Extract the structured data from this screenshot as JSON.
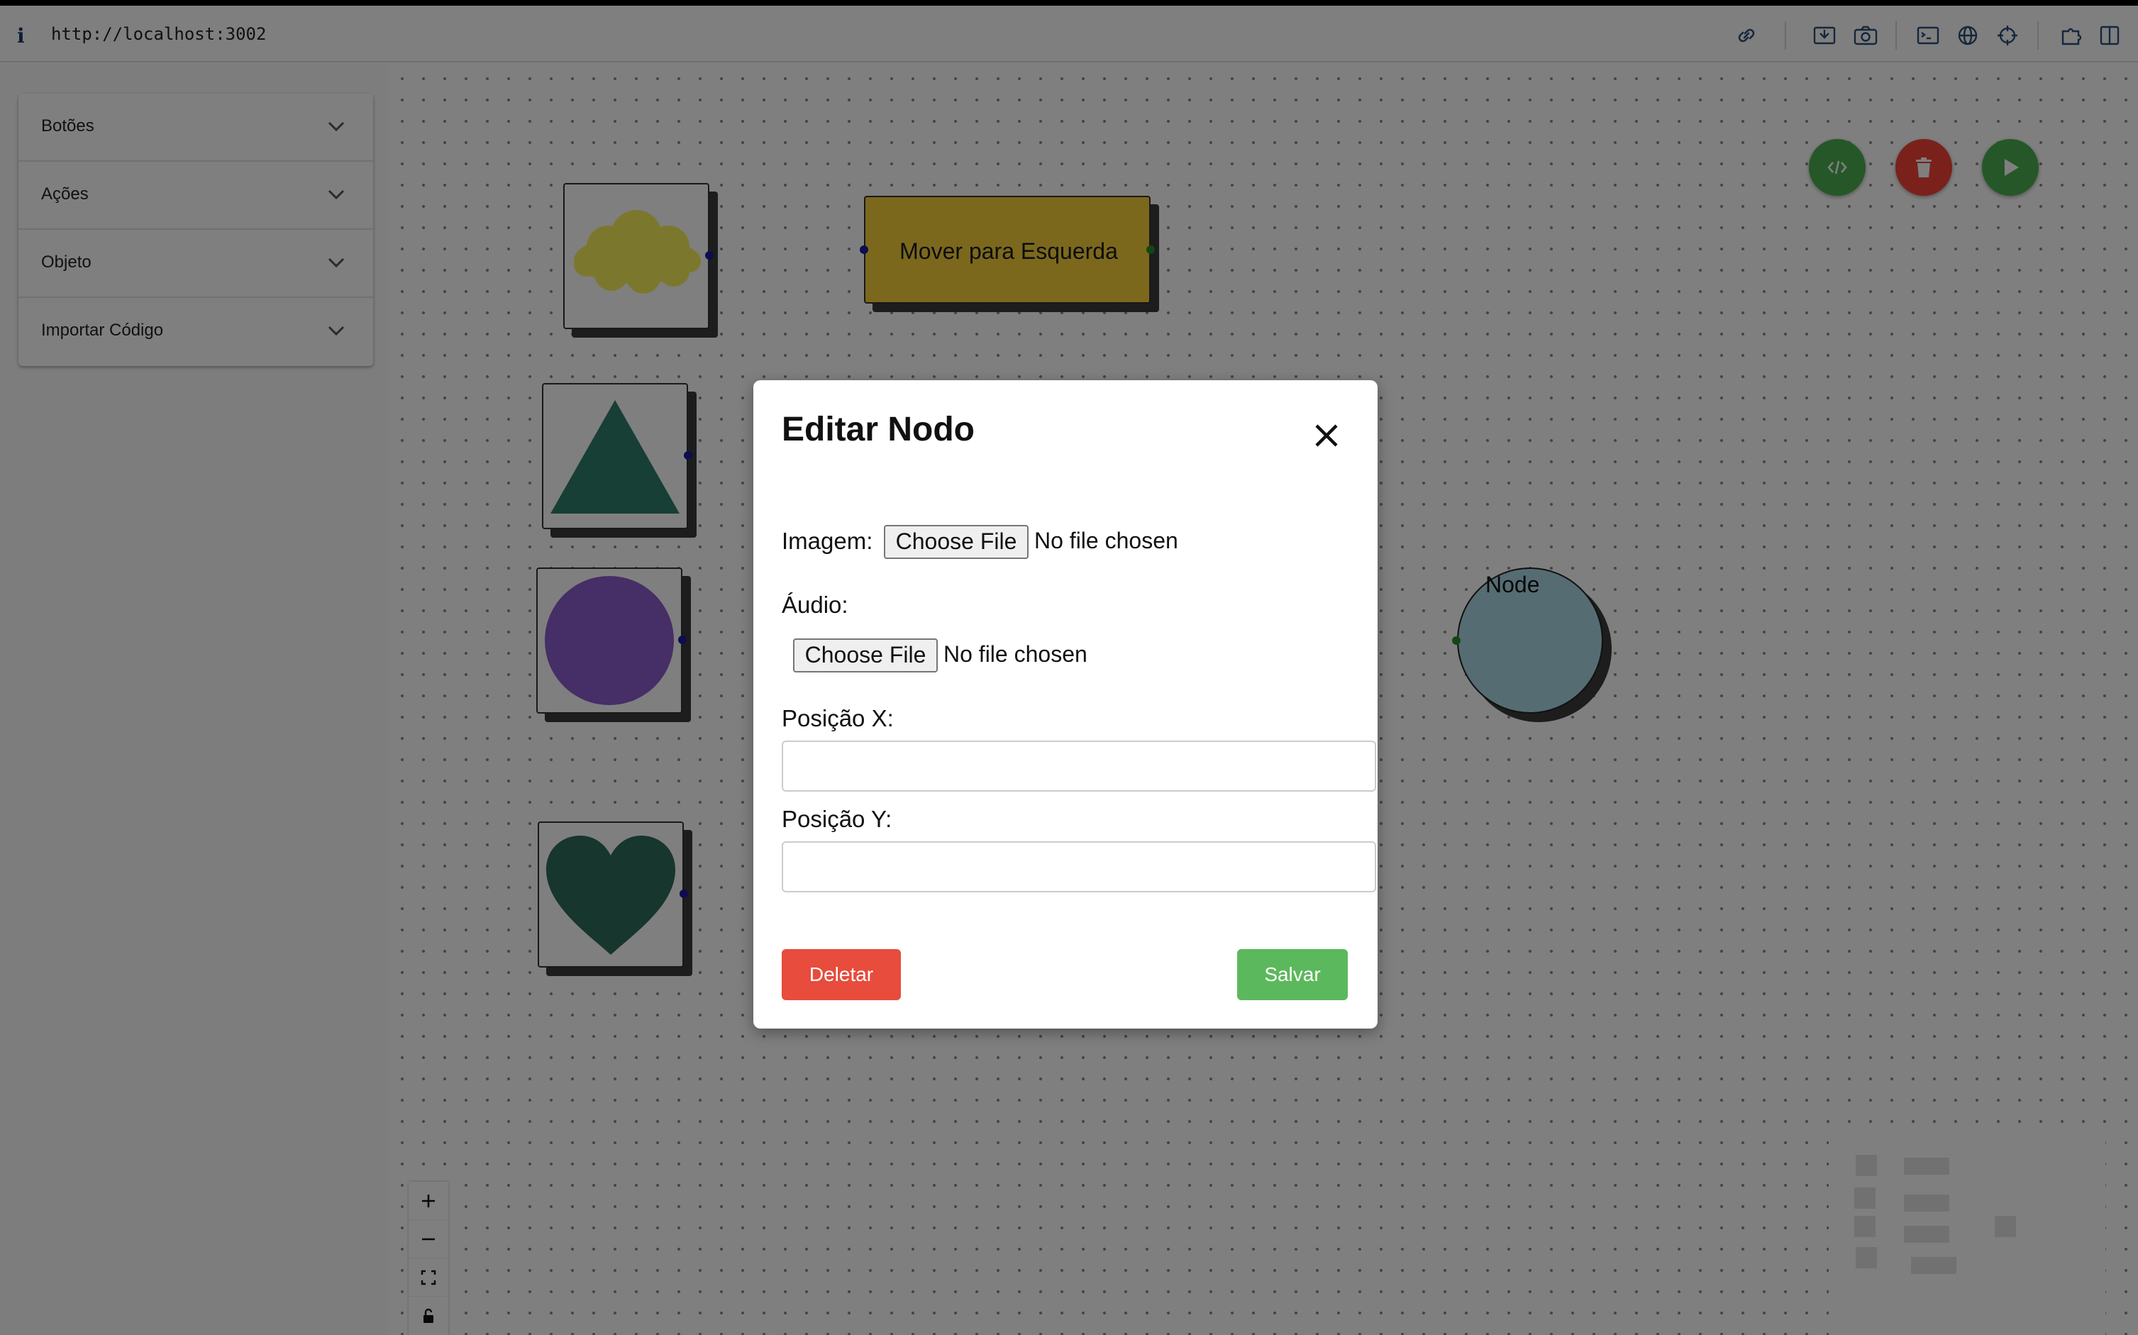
{
  "browser": {
    "info_glyph": "i",
    "url": "http://localhost:3002",
    "toolbar_icons": [
      "link-icon",
      "screenshot-region-icon",
      "camera-icon",
      "terminal-icon",
      "globe-icon",
      "crosshair-icon",
      "extension-icon",
      "sidebar-toggle-icon"
    ]
  },
  "sidebar": {
    "sections": [
      {
        "label": "Botões"
      },
      {
        "label": "Ações"
      },
      {
        "label": "Objeto"
      },
      {
        "label": "Importar Código"
      }
    ]
  },
  "canvas": {
    "nodes": {
      "cloud": {
        "color": "#f6f05a",
        "icon": "cloud-icon"
      },
      "triangle": {
        "color": "#2f7f6a",
        "icon": "triangle-icon"
      },
      "circle": {
        "color": "#8c5ccc",
        "icon": "circle-icon"
      },
      "heart": {
        "color": "#2f6c5a",
        "icon": "heart-icon"
      },
      "move_left": {
        "label": "Mover para Esquerda",
        "color": "#f7d13a"
      },
      "node_circle": {
        "label": "Node",
        "color": "#add8e6"
      }
    },
    "actions": [
      {
        "icon": "code-icon",
        "color": "#4caf50"
      },
      {
        "icon": "trash-icon",
        "color": "#f44336"
      },
      {
        "icon": "play-icon",
        "color": "#4caf50"
      }
    ],
    "zoom_controls": [
      "plus-icon",
      "minus-icon",
      "fit-view-icon",
      "lock-icon"
    ]
  },
  "modal": {
    "title": "Editar Nodo",
    "image_label": "Imagem:",
    "audio_label": "Áudio:",
    "file_button": "Choose File",
    "file_status": "No file chosen",
    "pos_x_label": "Posição X:",
    "pos_x_value": "",
    "pos_y_label": "Posição Y:",
    "pos_y_value": "",
    "delete_button": "Deletar",
    "save_button": "Salvar",
    "colors": {
      "delete": "#e74c3c",
      "save": "#5cb85c"
    }
  }
}
